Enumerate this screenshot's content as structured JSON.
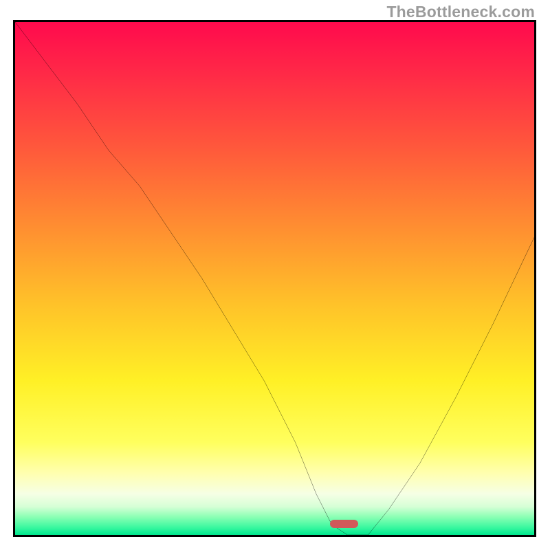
{
  "watermark": "TheBottleneck.com",
  "colors": {
    "frame": "#000000",
    "curve": "#000000",
    "marker": "#d15a5a",
    "gradient_stops": [
      {
        "offset": 0.0,
        "color": "#ff0a4d"
      },
      {
        "offset": 0.1,
        "color": "#ff2947"
      },
      {
        "offset": 0.25,
        "color": "#ff5a3b"
      },
      {
        "offset": 0.4,
        "color": "#ff8e31"
      },
      {
        "offset": 0.55,
        "color": "#ffc229"
      },
      {
        "offset": 0.7,
        "color": "#fff026"
      },
      {
        "offset": 0.82,
        "color": "#ffff5e"
      },
      {
        "offset": 0.88,
        "color": "#ffffb0"
      },
      {
        "offset": 0.92,
        "color": "#f6ffe5"
      },
      {
        "offset": 0.945,
        "color": "#d6ffd6"
      },
      {
        "offset": 0.965,
        "color": "#8bffb4"
      },
      {
        "offset": 0.985,
        "color": "#3cf8a0"
      },
      {
        "offset": 1.0,
        "color": "#00e88e"
      }
    ]
  },
  "chart_data": {
    "type": "line",
    "title": "",
    "xlabel": "",
    "ylabel": "",
    "xlim": [
      0,
      100
    ],
    "ylim": [
      0,
      100
    ],
    "x": [
      0,
      6,
      12,
      18,
      24,
      30,
      36,
      42,
      48,
      54,
      58,
      61,
      64,
      68,
      72,
      78,
      85,
      92,
      100
    ],
    "values": [
      100,
      92,
      84,
      75,
      68,
      59,
      50,
      40,
      30,
      18,
      8,
      2,
      0,
      0,
      5,
      14,
      27,
      41,
      58
    ],
    "minimum_x_range": [
      61,
      68
    ],
    "note": "V-shaped bottleneck curve over vertical heat gradient; x and y scaled 0–100 (relative). Values estimated visually."
  },
  "marker": {
    "left_frac": 0.606,
    "bottom_frac": 0.013,
    "width_frac": 0.055
  }
}
